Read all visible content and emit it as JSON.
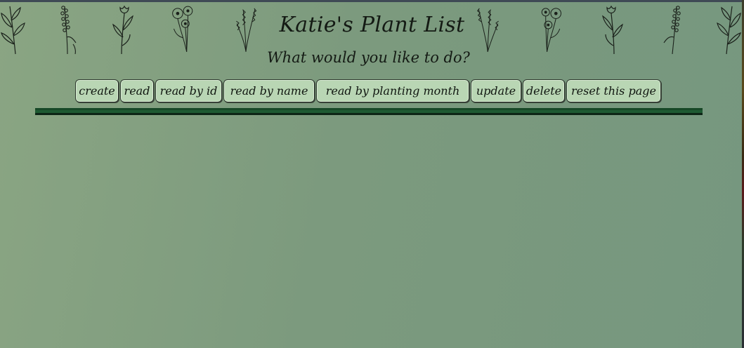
{
  "page": {
    "title": "Katie's Plant List",
    "subtitle": "What would you like to do?"
  },
  "toolbar": {
    "buttons": [
      {
        "label": "create"
      },
      {
        "label": "read"
      },
      {
        "label": "read by id"
      },
      {
        "label": "read by name"
      },
      {
        "label": "read by planting month"
      },
      {
        "label": "update"
      },
      {
        "label": "delete"
      },
      {
        "label": "reset this page"
      }
    ]
  },
  "decorations": {
    "icons": [
      "fern-sprig-icon",
      "lavender-sprig-icon",
      "tulip-stem-icon",
      "poppy-bouquet-icon",
      "lavender-bundle-icon",
      "lavender-bundle-icon",
      "poppy-bouquet-icon",
      "tulip-stem-icon",
      "lavender-sprig-icon",
      "fern-sprig-icon"
    ]
  },
  "colors": {
    "background": "#7c9a7e",
    "button_fill": "#b9d6b4",
    "divider": "#1e5a32",
    "ink": "#141a14"
  }
}
